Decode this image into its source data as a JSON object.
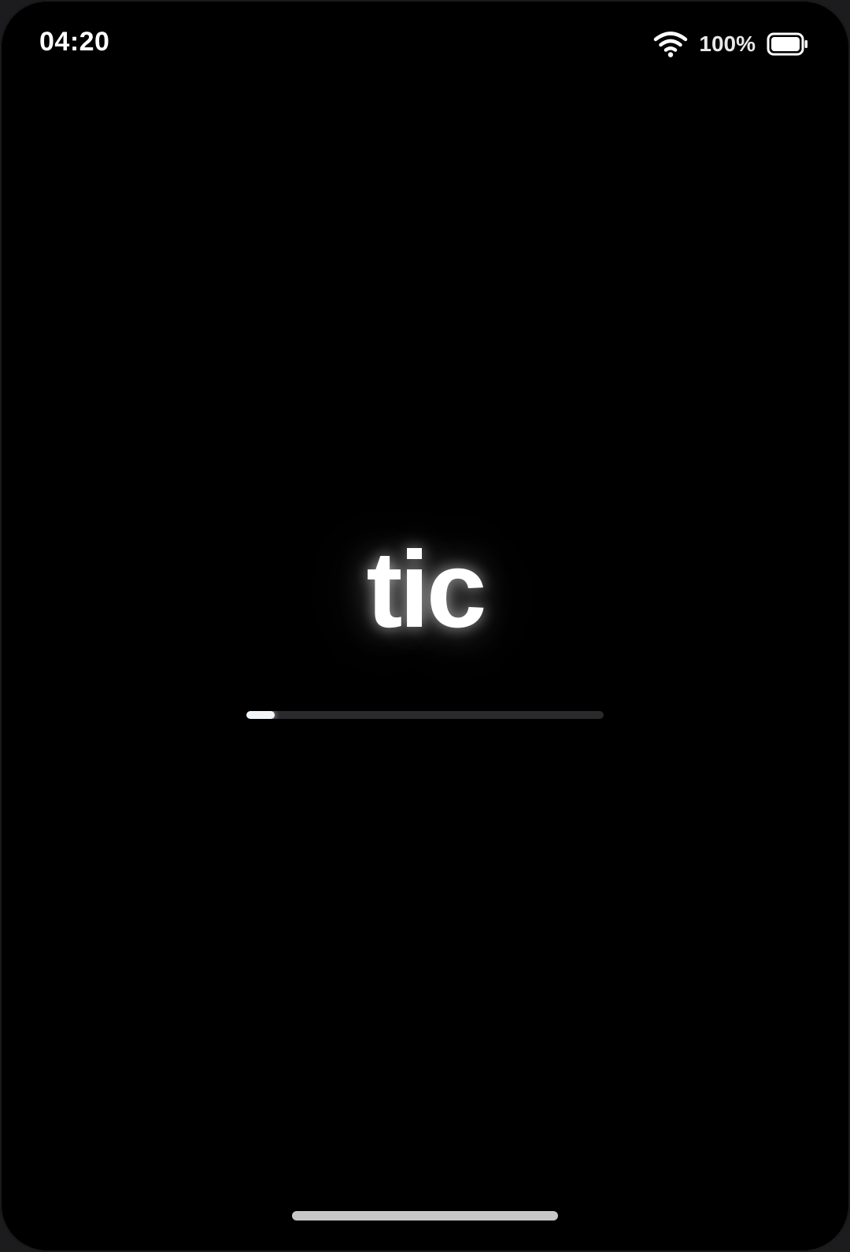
{
  "status_bar": {
    "time": "04:20",
    "battery_percent": "100%",
    "wifi_icon": "wifi-icon",
    "battery_icon": "battery-full-icon"
  },
  "splash": {
    "logo_text": "tic",
    "progress_fraction": 0.08
  },
  "colors": {
    "background": "#000000",
    "logo": "#ffffff",
    "progress_fill": "#f2f5f8",
    "progress_track": "#2a2a2c",
    "home_indicator": "#c8c8c8"
  }
}
